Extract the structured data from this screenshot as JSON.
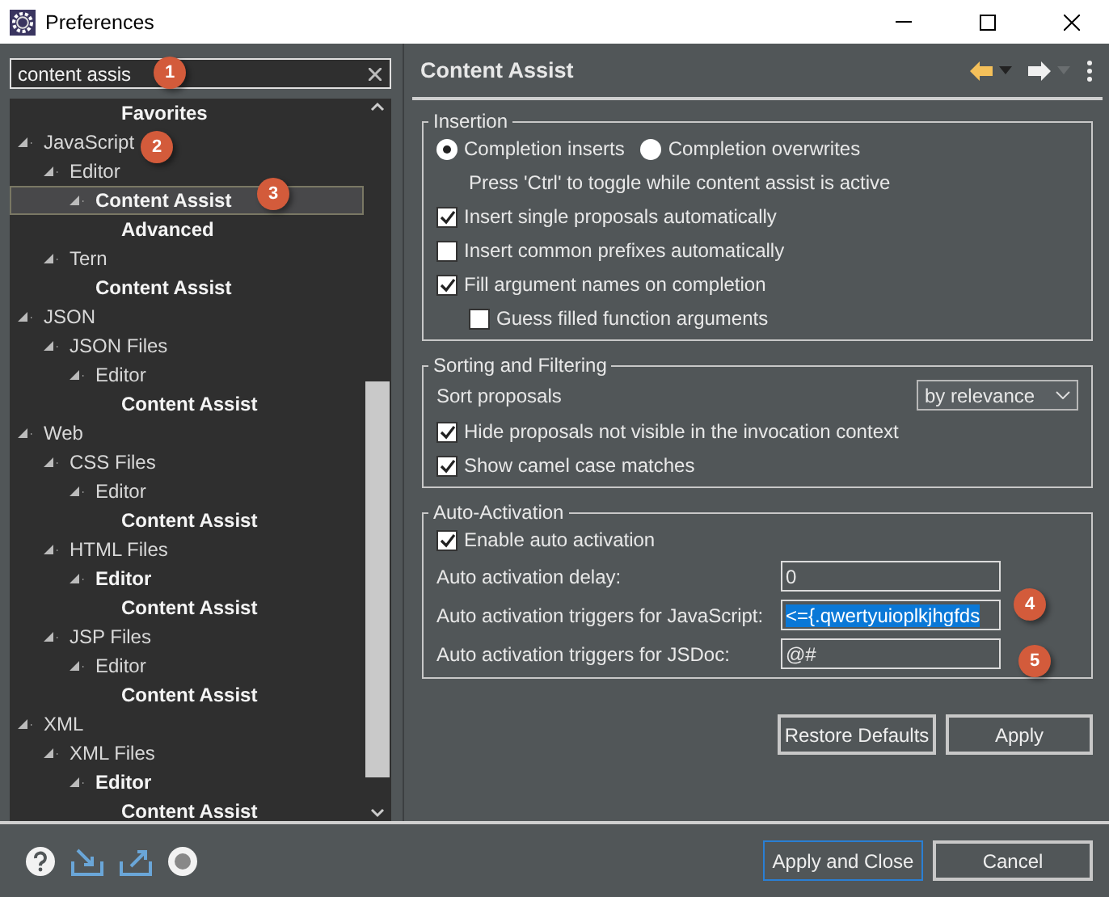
{
  "window": {
    "title": "Preferences"
  },
  "search": {
    "value": "content assis"
  },
  "tree": [
    {
      "label": "Favorites",
      "kind": "group",
      "match": true,
      "selected": false
    },
    {
      "label": "JavaScript",
      "match": false,
      "selected": false,
      "expanded": true,
      "children": [
        {
          "label": "Editor",
          "match": false,
          "selected": false,
          "expanded": true,
          "children": [
            {
              "label": "Content Assist",
              "match": true,
              "selected": true,
              "expanded": true,
              "children": [
                {
                  "label": "Advanced",
                  "match": true,
                  "selected": false
                }
              ]
            }
          ]
        },
        {
          "label": "Tern",
          "match": false,
          "selected": false,
          "expanded": true,
          "children": [
            {
              "label": "Content Assist",
              "match": true,
              "selected": false
            }
          ]
        }
      ]
    },
    {
      "label": "JSON",
      "match": false,
      "selected": false,
      "expanded": true,
      "children": [
        {
          "label": "JSON Files",
          "match": false,
          "selected": false,
          "expanded": true,
          "children": [
            {
              "label": "Editor",
              "match": false,
              "selected": false,
              "expanded": true,
              "children": [
                {
                  "label": "Content Assist",
                  "match": true,
                  "selected": false
                }
              ]
            }
          ]
        }
      ]
    },
    {
      "label": "Web",
      "match": false,
      "selected": false,
      "expanded": true,
      "children": [
        {
          "label": "CSS Files",
          "match": false,
          "selected": false,
          "expanded": true,
          "children": [
            {
              "label": "Editor",
              "match": false,
              "selected": false,
              "expanded": true,
              "children": [
                {
                  "label": "Content Assist",
                  "match": true,
                  "selected": false
                }
              ]
            }
          ]
        },
        {
          "label": "HTML Files",
          "match": false,
          "selected": false,
          "expanded": true,
          "children": [
            {
              "label": "Editor",
              "match": true,
              "selected": false,
              "expanded": true,
              "children": [
                {
                  "label": "Content Assist",
                  "match": true,
                  "selected": false
                }
              ]
            }
          ]
        },
        {
          "label": "JSP Files",
          "match": false,
          "selected": false,
          "expanded": true,
          "children": [
            {
              "label": "Editor",
              "match": false,
              "selected": false,
              "expanded": true,
              "children": [
                {
                  "label": "Content Assist",
                  "match": true,
                  "selected": false
                }
              ]
            }
          ]
        }
      ]
    },
    {
      "label": "XML",
      "match": false,
      "selected": false,
      "expanded": true,
      "children": [
        {
          "label": "XML Files",
          "match": false,
          "selected": false,
          "expanded": true,
          "children": [
            {
              "label": "Editor",
              "match": true,
              "selected": false,
              "expanded": true,
              "children": [
                {
                  "label": "Content Assist",
                  "match": true,
                  "selected": false
                }
              ]
            }
          ]
        }
      ]
    }
  ],
  "page": {
    "title": "Content Assist"
  },
  "insertion": {
    "legend": "Insertion",
    "radios": [
      {
        "label": "Completion inserts",
        "selected": true
      },
      {
        "label": "Completion overwrites",
        "selected": false
      }
    ],
    "note": "Press 'Ctrl' to toggle while content assist is active",
    "checkboxes": [
      {
        "label": "Insert single proposals automatically",
        "checked": true
      },
      {
        "label": "Insert common prefixes automatically",
        "checked": false
      },
      {
        "label": "Fill argument names on completion",
        "checked": true,
        "children": [
          {
            "label": "Guess filled function arguments",
            "checked": false
          }
        ]
      }
    ]
  },
  "sorting": {
    "legend": "Sorting and Filtering",
    "sort_label": "Sort proposals",
    "sort_value": "by relevance",
    "checkboxes": [
      {
        "label": "Hide proposals not visible in the invocation context",
        "checked": true
      },
      {
        "label": "Show camel case matches",
        "checked": true
      }
    ]
  },
  "auto_activation": {
    "legend": "Auto-Activation",
    "checkboxes": [
      {
        "label": "Enable auto activation",
        "checked": true
      }
    ],
    "fields": [
      {
        "label": "Auto activation delay:",
        "value": "0",
        "selected": false
      },
      {
        "label": "Auto activation triggers for JavaScript:",
        "value": "<={.qwertyuioplkjhgfds",
        "selected": true
      },
      {
        "label": "Auto activation triggers for JSDoc:",
        "value": "@#",
        "selected": false
      }
    ]
  },
  "page_buttons": [
    "Restore Defaults",
    "Apply"
  ],
  "dialog_buttons": [
    {
      "label": "Apply and Close",
      "default": true
    },
    {
      "label": "Cancel",
      "default": false
    }
  ],
  "callouts": [
    "1",
    "2",
    "3",
    "4",
    "5"
  ]
}
